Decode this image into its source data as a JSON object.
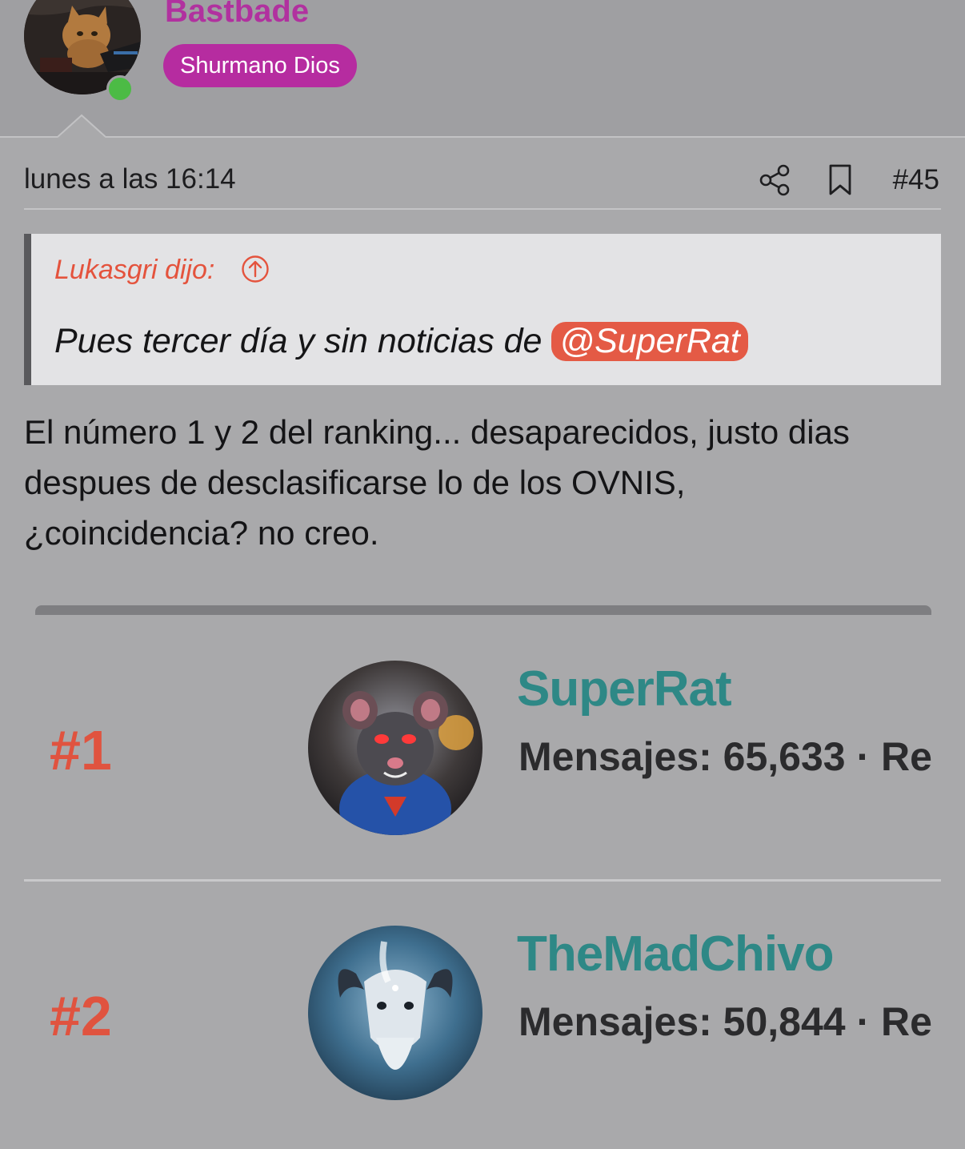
{
  "user": {
    "username": "Bastbade",
    "rank_title": "Shurmano Dios",
    "online": true,
    "colors": {
      "username": "#b1319f",
      "badge": "#b62ca0",
      "online": "#4cbb45"
    }
  },
  "post": {
    "date": "lunes a las 16:14",
    "number": "#45",
    "icons": {
      "share": "share-icon",
      "bookmark": "bookmark-icon"
    }
  },
  "quote": {
    "author": "Lukasgri dijo:",
    "text": "Pues tercer día y sin noticias de ",
    "mention": "@SuperRat",
    "colors": {
      "author": "#e4533d",
      "mention_bg": "#e45a45"
    }
  },
  "body": {
    "lines": [
      "El número 1 y 2 del ranking... desaparecidos, justo dias",
      "despues de desclasificarse lo de los OVNIS,",
      "¿coincidencia? no creo."
    ]
  },
  "ranking": {
    "entries": [
      {
        "rank": "#1",
        "name": "SuperRat",
        "stats": "Mensajes: 65,633 · Re"
      },
      {
        "rank": "#2",
        "name": "TheMadChivo",
        "stats": "Mensajes: 50,844 · Re"
      }
    ],
    "colors": {
      "rank": "#e0533f",
      "name": "#2e8886"
    }
  }
}
